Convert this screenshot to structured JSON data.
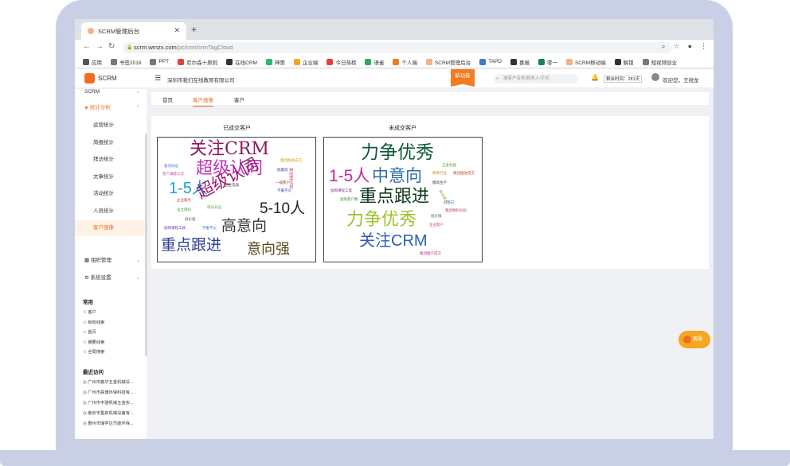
{
  "browser": {
    "tab_title": "SCRM管理后台",
    "url_host": "scrm.wmzx.com",
    "url_path": "/pc/crm/crmTagCloud"
  },
  "bookmarks": [
    {
      "label": "应用",
      "color": "#555555"
    },
    {
      "label": "书签2018",
      "color": "#777777"
    },
    {
      "label": "PPT",
      "color": "#777777"
    },
    {
      "label": "尼尔森十原则",
      "color": "#e0453a"
    },
    {
      "label": "在线CRM",
      "color": "#333333"
    },
    {
      "label": "神策",
      "color": "#2bb673"
    },
    {
      "label": "企业端",
      "color": "#f5a623"
    },
    {
      "label": "今日热榜",
      "color": "#e0453a"
    },
    {
      "label": "语雀",
      "color": "#27ae60"
    },
    {
      "label": "个人端",
      "color": "#e67e22"
    },
    {
      "label": "SCRM管理后台",
      "color": "#f4b183"
    },
    {
      "label": "TAPD",
      "color": "#3a7bd5"
    },
    {
      "label": "喜报",
      "color": "#333333"
    },
    {
      "label": "零一",
      "color": "#1a7f5a"
    },
    {
      "label": "SCRM移动端",
      "color": "#f4b183"
    },
    {
      "label": "解锁",
      "color": "#333333"
    },
    {
      "label": "短视频创业",
      "color": "#777777"
    }
  ],
  "header": {
    "logo_text": "SCRM",
    "company": "深圳市我们在线教育有限公司",
    "new_feature": "新功能",
    "search_placeholder": "搜客户名称/联系人/手机",
    "remaining": "剩余时间：281天",
    "welcome": "欢迎您，王锐龙"
  },
  "sidebar": {
    "top_cut": "SCRM",
    "stats_parent": "统计分析",
    "stats_children": [
      "运营统计",
      "简报统计",
      "拜访统计",
      "文章统计",
      "活动统计",
      "人员统计",
      "客户画像"
    ],
    "org": "组织管理",
    "settings": "系统设置",
    "common_title": "常用",
    "common_items": [
      "客户",
      "有效线索",
      "首页",
      "摘要线索",
      "全局搜索"
    ],
    "recent_title": "最近访问",
    "recent_items": [
      "广州市鑫华五金机械设...",
      "广州市高博环保科技有...",
      "广州市丰骆机械五金实...",
      "南京宇盈启机械设备有...",
      "惠州市瑞学达节能环保..."
    ]
  },
  "page_tabs": [
    "首页",
    "客户画像",
    "客户"
  ],
  "clouds": {
    "closed_title": "已成交客户",
    "open_title": "未成交客户",
    "closed_words": [
      {
        "text": "关注CRM",
        "color": "#8e1a5e"
      },
      {
        "text": "超级认同",
        "color": "#c42dbd"
      },
      {
        "text": "1-5人",
        "color": "#1aa3d6"
      },
      {
        "text": "超级认同",
        "color": "#9b1a6e"
      },
      {
        "text": "5-10人",
        "color": "#222222"
      },
      {
        "text": "高意向",
        "color": "#333333"
      },
      {
        "text": "重点跟进",
        "color": "#2a3f8f"
      },
      {
        "text": "意向强",
        "color": "#5a4a1a"
      },
      {
        "text": "集团推进成交",
        "color": "#d9a020"
      },
      {
        "text": "意向协议",
        "color": "#3a6fc4"
      },
      {
        "text": "企业服务",
        "color": "#c43a3a"
      },
      {
        "text": "设立目标",
        "color": "#3fa535"
      },
      {
        "text": "低价值",
        "color": "#555555"
      },
      {
        "text": "加购课程工具",
        "color": "#6a2ac4"
      },
      {
        "text": "不服不火",
        "color": "#2a6fc4"
      },
      {
        "text": "五金电器",
        "color": "#555555"
      },
      {
        "text": "集团物料扫码",
        "color": "#c43a6a"
      },
      {
        "text": "低意向",
        "color": "#2a2a8f"
      },
      {
        "text": "一般客户",
        "color": "#7a3a1a"
      },
      {
        "text": "客户满意认可",
        "color": "#c44a8a"
      },
      {
        "text": "不服不火",
        "color": "#3a3ac4"
      },
      {
        "text": "目光长远",
        "color": "#5aa53a"
      }
    ],
    "open_words": [
      {
        "text": "力争优秀",
        "color": "#0e5a3a"
      },
      {
        "text": "1-5人",
        "color": "#c42d8f"
      },
      {
        "text": "中意向",
        "color": "#2a6faa"
      },
      {
        "text": "重点跟进",
        "color": "#0e3a1a"
      },
      {
        "text": "力争优秀",
        "color": "#9ac42a"
      },
      {
        "text": "关注CRM",
        "color": "#2a5fb4"
      },
      {
        "text": "加购课程工具",
        "color": "#7a2a8f"
      },
      {
        "text": "加购客户数",
        "color": "#3a8f4a"
      },
      {
        "text": "集团推进成交",
        "color": "#c44a2a"
      },
      {
        "text": "教育行业",
        "color": "#c48a2a"
      },
      {
        "text": "五金机器",
        "color": "#5aa52a"
      },
      {
        "text": "模具生产",
        "color": "#3a3a3a"
      },
      {
        "text": "低意向",
        "color": "#2a6fc4"
      },
      {
        "text": "集团物料扫码",
        "color": "#c43a6a"
      },
      {
        "text": "低价值",
        "color": "#555555"
      },
      {
        "text": "企业客户",
        "color": "#c43a3a"
      },
      {
        "text": "集团推介成交",
        "color": "#c42d8f"
      },
      {
        "text": "协议客户",
        "color": "#8fa52a"
      }
    ]
  },
  "float_button": "客服"
}
